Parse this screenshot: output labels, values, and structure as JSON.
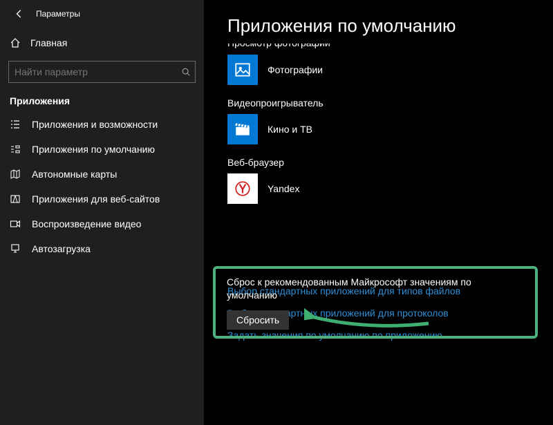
{
  "window_title": "Параметры",
  "home_label": "Главная",
  "search_placeholder": "Найти параметр",
  "sidebar_section": "Приложения",
  "nav": [
    "Приложения и возможности",
    "Приложения по умолчанию",
    "Автономные карты",
    "Приложения для веб-сайтов",
    "Воспроизведение видео",
    "Автозагрузка"
  ],
  "page_heading": "Приложения по умолчанию",
  "cutoff_group_label": "Просмотр фотографий",
  "groups": {
    "photos_app": "Фотографии",
    "video": "Видеопроигрыватель",
    "video_app": "Кино и ТВ",
    "browser": "Веб-браузер",
    "browser_app": "Yandex"
  },
  "reset": {
    "text": "Сброс к рекомендованным Майкрософт значениям по умолчанию",
    "button": "Сбросить"
  },
  "links": [
    "Выбор стандартных приложений для типов файлов",
    "Выбор стандартных приложений для протоколов",
    "Задать значения по умолчанию по приложению"
  ]
}
